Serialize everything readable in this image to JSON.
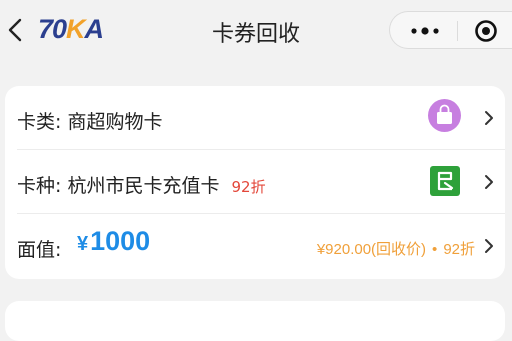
{
  "header": {
    "logo_part1": "70",
    "logo_part2": "K",
    "logo_part3": "A",
    "title": "卡券回收",
    "back_icon": "chevron-left-icon",
    "more_icon": "more-dots-icon",
    "close_icon": "target-close-icon"
  },
  "form": {
    "card_type": {
      "label": "卡类:",
      "value": "商超购物卡",
      "icon": "shopping-bag-icon"
    },
    "card_kind": {
      "label": "卡种:",
      "value": "杭州市民卡充值卡",
      "discount": "92折",
      "icon": "citizen-card-icon"
    },
    "face_value": {
      "label": "面值:",
      "currency": "¥",
      "amount": "1000",
      "recycle_price": "¥920.00(回收价)",
      "separator": "•",
      "discount": "92折"
    }
  },
  "colors": {
    "accent_blue": "#1e8ce6",
    "discount_red": "#e3473a",
    "recycle_orange": "#f0a03a",
    "bag_purple": "#c77fe0",
    "citizen_green": "#2ea13a"
  }
}
